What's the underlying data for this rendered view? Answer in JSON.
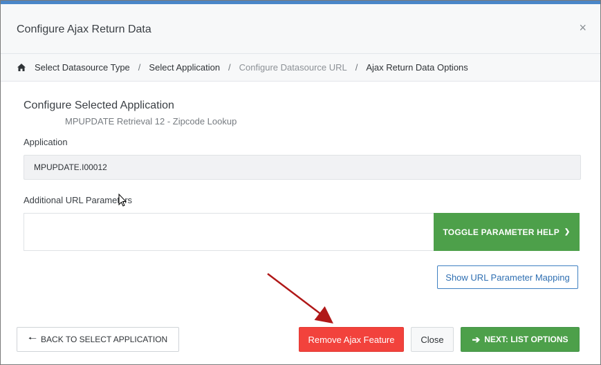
{
  "modal": {
    "title": "Configure Ajax Return Data",
    "close_glyph": "×"
  },
  "breadcrumb": {
    "items": [
      {
        "label": "Select Datasource Type"
      },
      {
        "label": "Select Application"
      },
      {
        "label": "Configure Datasource URL"
      },
      {
        "label": "Ajax Return Data Options"
      }
    ],
    "separator": "/"
  },
  "section": {
    "title": "Configure Selected Application",
    "subtitle": "MPUPDATE Retrieval 12 - Zipcode Lookup"
  },
  "application": {
    "label": "Application",
    "value": "MPUPDATE.I00012"
  },
  "url_params": {
    "label": "Additional URL Parameters",
    "value": "",
    "toggle_label": "TOGGLE PARAMETER HELP"
  },
  "mapping_button": {
    "label": "Show URL Parameter Mapping"
  },
  "footer": {
    "back_label": "BACK TO SELECT APPLICATION",
    "remove_label": "Remove Ajax Feature",
    "close_label": "Close",
    "next_label": "NEXT: LIST OPTIONS"
  },
  "colors": {
    "accent_blue": "#4a86c8",
    "success_green": "#4da04a",
    "danger_red": "#f2423c",
    "annotation_red": "#b01818"
  }
}
